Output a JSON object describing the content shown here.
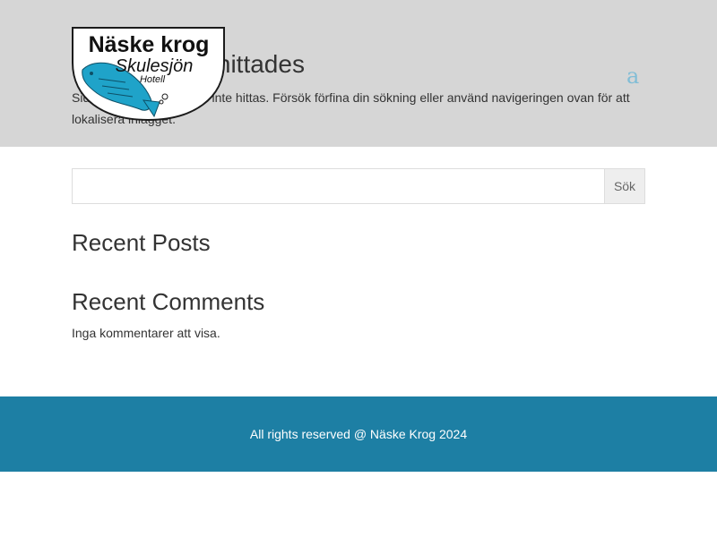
{
  "header": {
    "title": "Inga resultat hittades",
    "message": "Sidan du begärde kunde inte hittas. Försök förfina din sökning eller använd navigeringen ovan för att lokalisera inlägget.",
    "search_icon": "search-icon",
    "search_glyph": "a",
    "logo": {
      "line1": "Näske krog",
      "line2": "Skulesjön",
      "line3": "Hotell"
    }
  },
  "search": {
    "value": "",
    "placeholder": "",
    "button_label": "Sök"
  },
  "sidebar": {
    "recent_posts_title": "Recent Posts",
    "recent_comments_title": "Recent Comments",
    "no_comments": "Inga kommentarer att visa."
  },
  "footer": {
    "text": "All rights reserved @ Näske Krog 2024"
  },
  "colors": {
    "header_bg": "#d6d6d6",
    "footer_bg": "#1d7fa4",
    "accent": "#2ea3f2",
    "logo_fish": "#1fa3c9"
  }
}
